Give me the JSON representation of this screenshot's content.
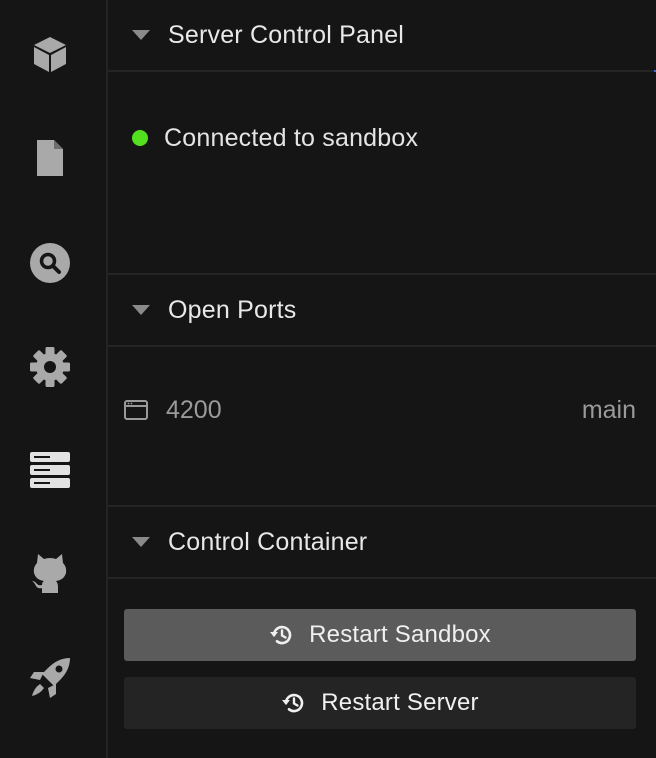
{
  "sidebar": {
    "icons": [
      "box-icon",
      "file-icon",
      "search-icon",
      "gear-icon",
      "server-icon",
      "github-icon",
      "rocket-icon"
    ]
  },
  "server_control": {
    "title": "Server Control Panel",
    "status_text": "Connected to sandbox",
    "status_color": "#52e01f"
  },
  "open_ports": {
    "title": "Open Ports",
    "ports": [
      {
        "number": "4200",
        "name": "main"
      }
    ]
  },
  "control_container": {
    "title": "Control Container",
    "restart_sandbox_label": "Restart Sandbox",
    "restart_server_label": "Restart Server"
  },
  "colors": {
    "background": "#151515",
    "divider": "#242424",
    "primary_button": "#5b5b5b",
    "secondary_button": "#242424"
  }
}
